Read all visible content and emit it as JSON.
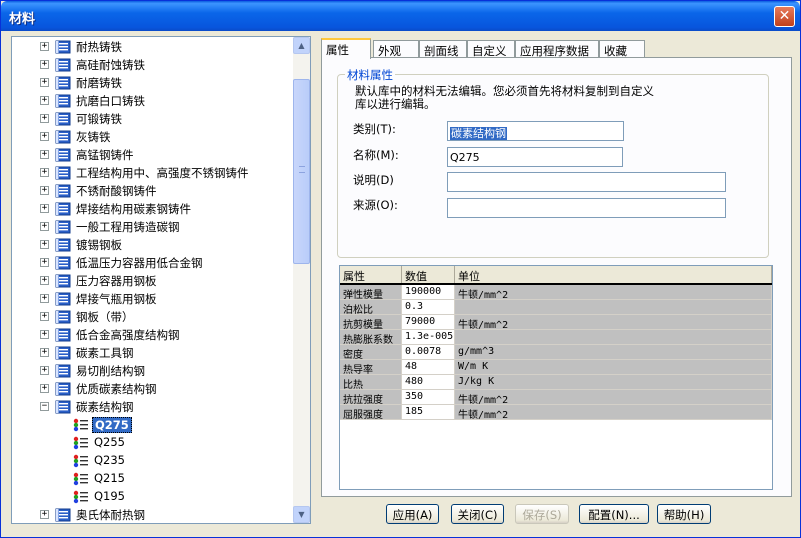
{
  "window": {
    "title": "材料"
  },
  "tree": {
    "items": [
      {
        "label": "耐热铸铁",
        "exp": "+"
      },
      {
        "label": "高硅耐蚀铸铁",
        "exp": "+"
      },
      {
        "label": "耐磨铸铁",
        "exp": "+"
      },
      {
        "label": "抗磨白口铸铁",
        "exp": "+"
      },
      {
        "label": "可锻铸铁",
        "exp": "+"
      },
      {
        "label": "灰铸铁",
        "exp": "+"
      },
      {
        "label": "高锰钢铸件",
        "exp": "+"
      },
      {
        "label": "工程结构用中、高强度不锈钢铸件",
        "exp": "+"
      },
      {
        "label": "不锈耐酸钢铸件",
        "exp": "+"
      },
      {
        "label": "焊接结构用碳素钢铸件",
        "exp": "+"
      },
      {
        "label": "一般工程用铸造碳钢",
        "exp": "+"
      },
      {
        "label": "镀锡钢板",
        "exp": "+"
      },
      {
        "label": "低温压力容器用低合金钢",
        "exp": "+"
      },
      {
        "label": "压力容器用钢板",
        "exp": "+"
      },
      {
        "label": "焊接气瓶用钢板",
        "exp": "+"
      },
      {
        "label": "钢板（带）",
        "exp": "+"
      },
      {
        "label": "低合金高强度结构钢",
        "exp": "+"
      },
      {
        "label": "碳素工具钢",
        "exp": "+"
      },
      {
        "label": "易切削结构钢",
        "exp": "+"
      },
      {
        "label": "优质碳素结构钢",
        "exp": "+"
      },
      {
        "label": "碳素结构钢",
        "exp": "−"
      }
    ],
    "children": [
      {
        "label": "Q275",
        "selected": true
      },
      {
        "label": "Q255"
      },
      {
        "label": "Q235"
      },
      {
        "label": "Q215"
      },
      {
        "label": "Q195"
      }
    ],
    "last_item": {
      "label": "奥氏体耐热钢",
      "exp": "+"
    }
  },
  "tabs": [
    "属性",
    "外观",
    "剖面线",
    "自定义",
    "应用程序数据",
    "收藏"
  ],
  "properties": {
    "group_title": "材料属性",
    "note": "默认库中的材料无法编辑。您必须首先将材料复制到自定义库以进行编辑。",
    "category_label": "类别(T):",
    "category_value": "碳素结构钢",
    "name_label": "名称(M):",
    "name_value": "Q275",
    "desc_label": "说明(D)",
    "desc_value": "",
    "source_label": "来源(O):",
    "source_value": ""
  },
  "grid": {
    "headers": [
      "属性",
      "数值",
      "单位"
    ],
    "rows": [
      [
        "弹性模量",
        "190000",
        "牛顿/mm^2"
      ],
      [
        "泊松比",
        "0.3",
        ""
      ],
      [
        "抗剪模量",
        "79000",
        "牛顿/mm^2"
      ],
      [
        "热膨胀系数",
        "1.3e-005",
        ""
      ],
      [
        "密度",
        "0.0078",
        "g/mm^3"
      ],
      [
        "热导率",
        "48",
        "W/m K"
      ],
      [
        "比热",
        "480",
        "J/kg K"
      ],
      [
        "抗拉强度",
        "350",
        "牛顿/mm^2"
      ],
      [
        "屈服强度",
        "185",
        "牛顿/mm^2"
      ]
    ]
  },
  "buttons": {
    "apply": "应用(A)",
    "close": "关闭(C)",
    "save": "保存(S)",
    "config": "配置(N)...",
    "help": "帮助(H)"
  }
}
